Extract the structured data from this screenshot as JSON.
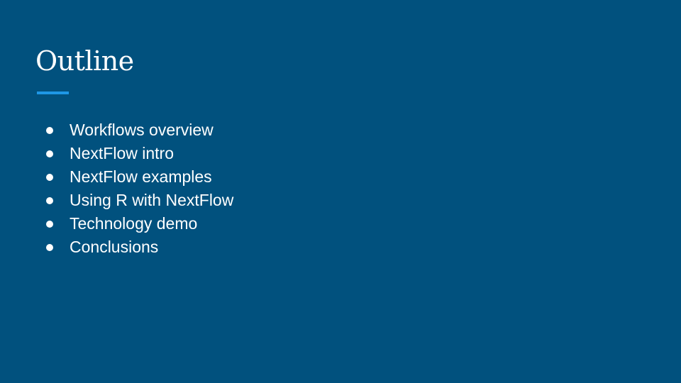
{
  "slide": {
    "title": "Outline",
    "accent_color": "#1e97e6",
    "background_color": "#01517e",
    "bullets": [
      "Workflows overview",
      "NextFlow intro",
      "NextFlow examples",
      "Using R with NextFlow",
      "Technology demo",
      "Conclusions"
    ]
  }
}
